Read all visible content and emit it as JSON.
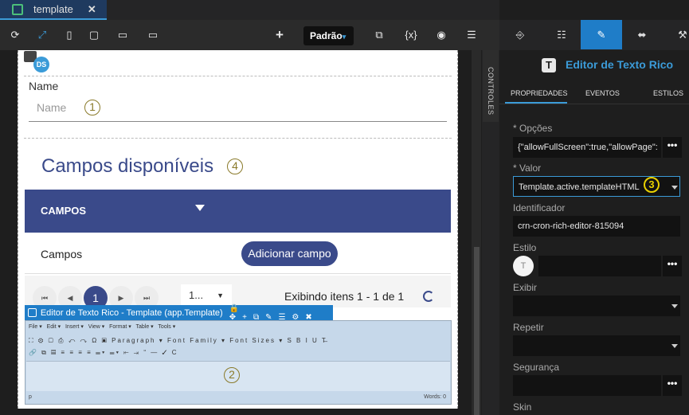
{
  "tab": {
    "label": "template",
    "close": "✕"
  },
  "toolbar": {
    "dropdown": "Padrão",
    "var_label": "{x}"
  },
  "canvas": {
    "name_label": "Name",
    "name_placeholder": "Name",
    "marker1": "1",
    "marker2": "2",
    "marker4": "4",
    "ds_badge": "DS",
    "campos_title": "Campos disponíveis",
    "table_header": "CAMPOS",
    "row_cell": "Campos",
    "add_button": "Adicionar campo",
    "pager_page": "1",
    "pager_size": "1...",
    "pager_info": "Exibindo itens 1 - 1 de 1"
  },
  "rich_editor": {
    "title": "Editor de Texto Rico - Template (app.Template)",
    "menu": [
      "File ▾",
      "Edit ▾",
      "Insert ▾",
      "View ▾",
      "Format ▾",
      "Table ▾",
      "Tools ▾"
    ],
    "row1": "⛶ ⚙ ▢ ⎙ ↶ ↷ Ω ▣  Paragraph ▾   Font Family ▾   Font Sizes ▾  S B I U T̶",
    "row2": "🔗 ⧉ ▤ ≡ ≡ ≡ ≡ ☰▾ ☰▾ ⇤ ⇥ “ ― ✓ C",
    "status": "p",
    "words": "Words: 0"
  },
  "controls_label": "CONTROLES",
  "panel": {
    "title": "Editor de Texto Rico",
    "subtabs": [
      "PROPRIEDADES",
      "EVENTOS",
      "ESTILOS"
    ],
    "fields": {
      "opcoes_label": "* Opções",
      "opcoes_value": "{\"allowFullScreen\":true,\"allowPage\":",
      "valor_label": "* Valor",
      "valor_value": "Template.active.templateHTML",
      "marker3": "3",
      "identificador_label": "Identificador",
      "identificador_value": "crn-cron-rich-editor-815094",
      "estilo_label": "Estilo",
      "estilo_avatar": "T",
      "exibir_label": "Exibir",
      "repetir_label": "Repetir",
      "seguranca_label": "Segurança",
      "skin_label": "Skin",
      "dots": "•••"
    }
  },
  "colors": {
    "accent": "#3b9bd8",
    "primary": "#3a4a8a",
    "editor_blue": "#1f7dc8",
    "marker_yellow": "#e8d100"
  },
  "icons": [
    "refresh-icon",
    "expand-icon",
    "phone-icon",
    "tablet-icon",
    "desktop-icon",
    "monitor-icon",
    "plus-icon",
    "preview-icon",
    "variable-icon",
    "eye-icon",
    "database-icon",
    "import-icon",
    "tree-icon",
    "pencil-icon",
    "resize-icon",
    "tools-icon",
    "filter-icon",
    "refresh-icon"
  ]
}
